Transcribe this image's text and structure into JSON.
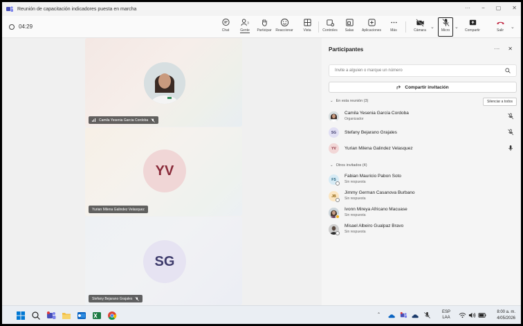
{
  "window": {
    "title": "Reunión de capacitación indicadores puesta en marcha",
    "controls": [
      "···",
      "−",
      "▢",
      "✕"
    ]
  },
  "toolbar": {
    "timer": "04:29",
    "items": [
      {
        "label": "Chat",
        "icon": "chat-icon"
      },
      {
        "label": "Gente",
        "icon": "people-icon",
        "badge": "3"
      },
      {
        "label": "Participar",
        "icon": "raise-hand-icon"
      },
      {
        "label": "Reaccionar",
        "icon": "emoji-icon"
      },
      {
        "label": "Vista",
        "icon": "grid-view-icon"
      },
      {
        "label": "Controles",
        "icon": "controls-icon"
      },
      {
        "label": "Salas",
        "icon": "rooms-icon"
      },
      {
        "label": "Aplicaciones",
        "icon": "apps-icon"
      },
      {
        "label": "Más",
        "icon": "more-icon"
      },
      {
        "label": "Cámara",
        "icon": "camera-off-icon"
      },
      {
        "label": "Micro",
        "icon": "mic-off-icon"
      },
      {
        "label": "Compartir",
        "icon": "share-icon"
      },
      {
        "label": "Salir",
        "icon": "hang-up-icon"
      }
    ]
  },
  "stage": {
    "tiles": [
      {
        "name": "Camila Yesenia Garcia Cordoba",
        "initials": ""
      },
      {
        "name": "Yurian Milena Galindez Velasquez",
        "initials": "YV"
      },
      {
        "name": "Stefany Bejarano Grajales",
        "initials": "SG"
      }
    ]
  },
  "panel": {
    "title": "Participantes",
    "invite_placeholder": "Invite a alguien o marque un número",
    "share_label": "Compartir invitación",
    "in_meeting_label": "En esta reunión (3)",
    "mute_all_label": "Silenciar a todos",
    "in_meeting": [
      {
        "name": "Camila Yesenia García Cordoba",
        "role": "Organizador",
        "initials": ""
      },
      {
        "name": "Stefany Bejarano Grajales",
        "role": "",
        "initials": "SG"
      },
      {
        "name": "Yurian Milena Galindez Velasquez",
        "role": "",
        "initials": "YV"
      }
    ],
    "invited_label": "Otros invitados (4)",
    "invited": [
      {
        "name": "Fabian Mauricio Pabon Soto",
        "status": "Sin respuesta",
        "initials": "FS"
      },
      {
        "name": "Jimmy German Casanova Burbano",
        "status": "Sin respuesta",
        "initials": "JB"
      },
      {
        "name": "Ivonn Mireya Africano Macuase",
        "status": "Sin respuesta",
        "initials": ""
      },
      {
        "name": "Misael Albeiro Gualpaz Bravo",
        "status": "Sin respuesta",
        "initials": ""
      }
    ]
  },
  "taskbar": {
    "language": "ESP",
    "layout": "LAA",
    "time": "8:00 a. m.",
    "date": "4/05/2026"
  },
  "colors": {
    "accent": "#5b5fc7",
    "hangup": "#c4314b",
    "teams": "#464eb8"
  }
}
